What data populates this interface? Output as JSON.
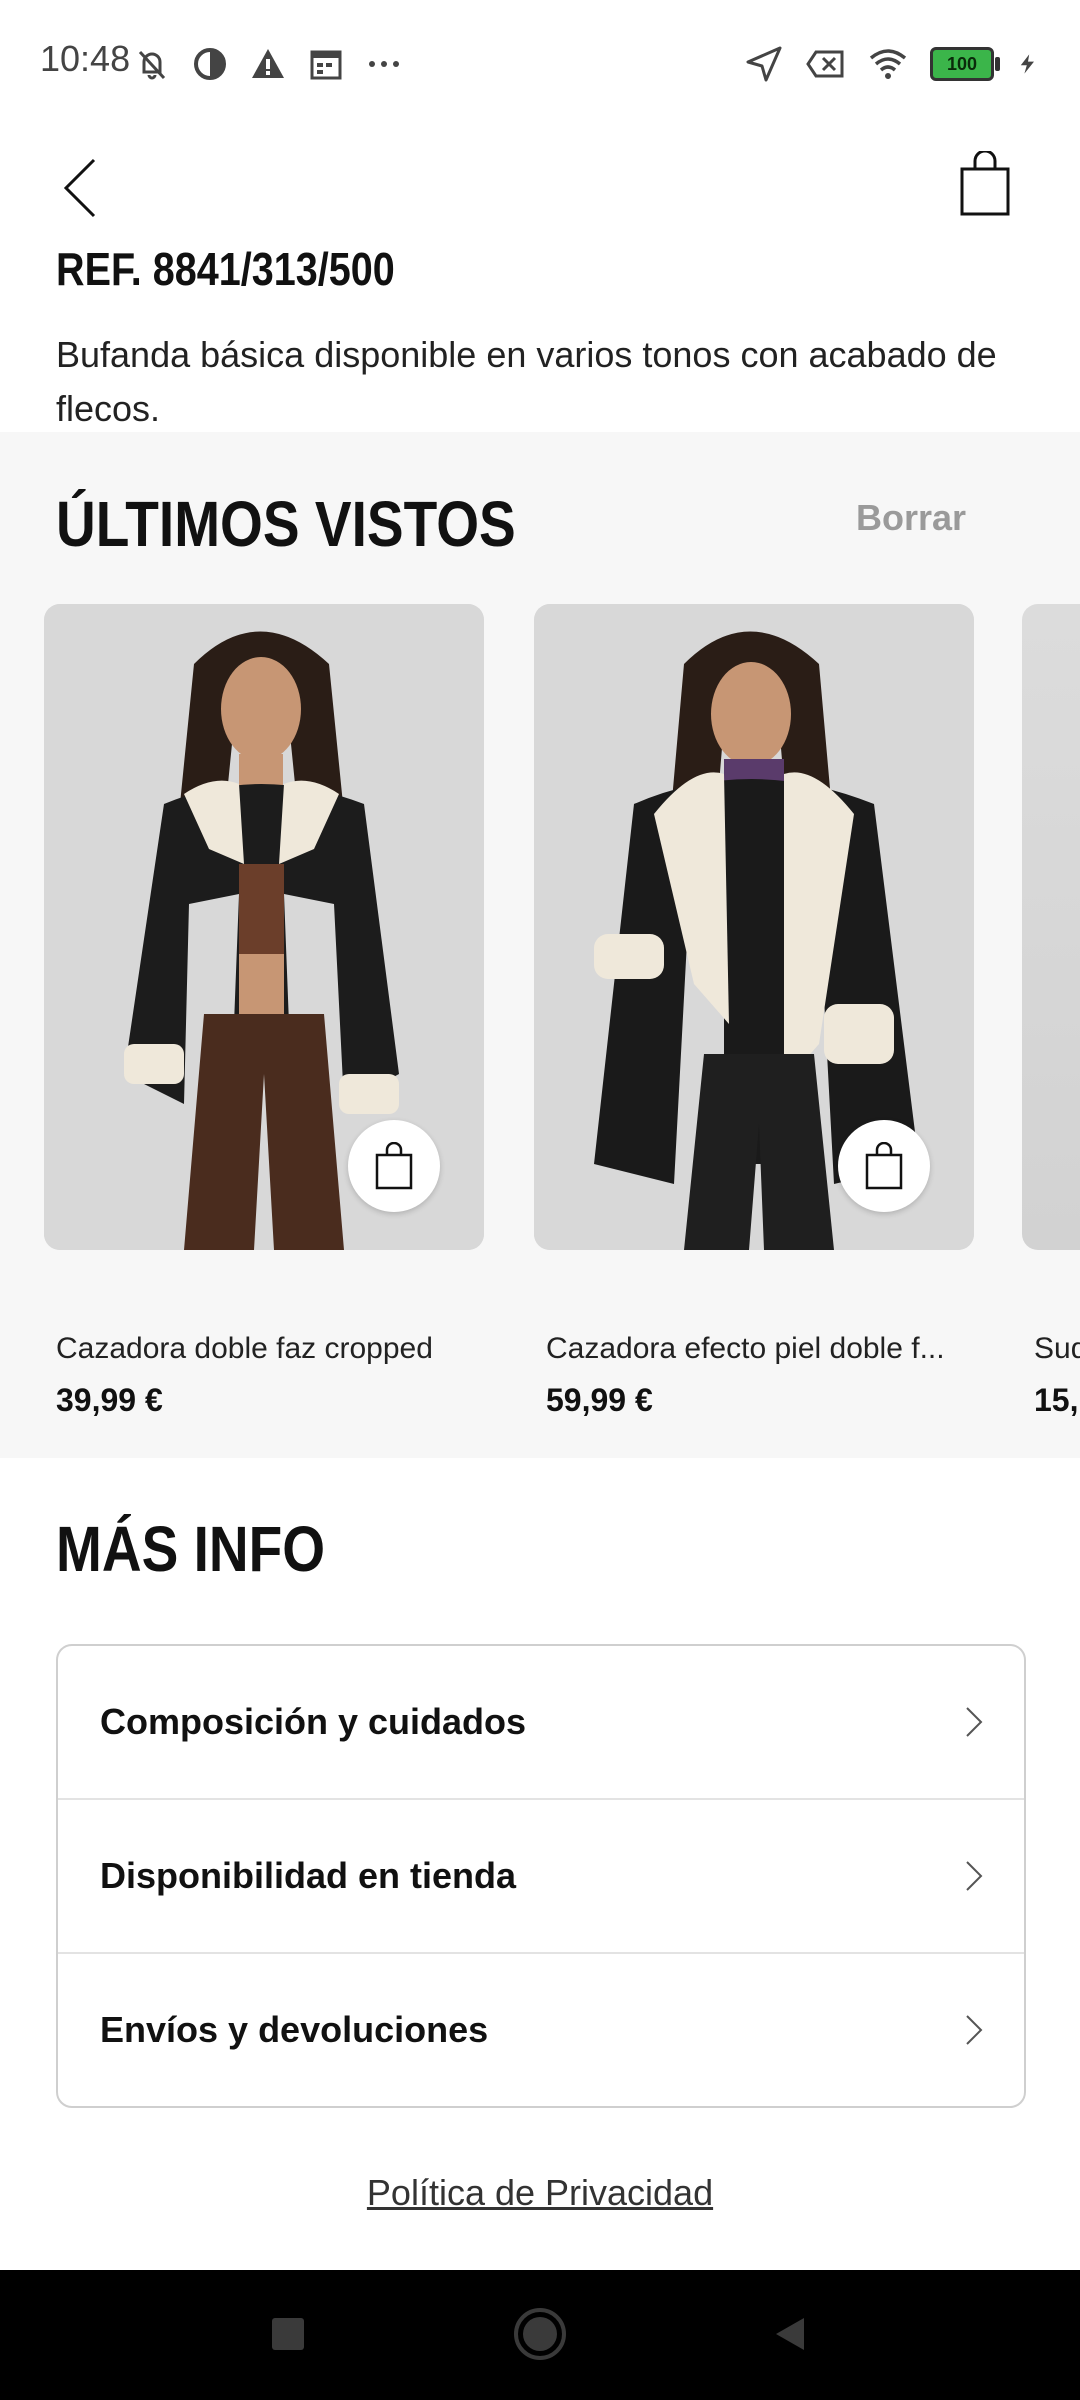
{
  "status_bar": {
    "time": "10:48",
    "battery": "100",
    "left_icons": [
      "mute-icon",
      "data-saver-icon",
      "warning-icon",
      "calendar-icon",
      "more-dots-icon"
    ],
    "right_icons": [
      "location-icon",
      "no-sim-icon",
      "wifi-icon",
      "battery-icon",
      "charging-icon"
    ]
  },
  "top_bar": {
    "back_icon": "back-chevron-icon",
    "bag_icon": "shopping-bag-icon"
  },
  "product": {
    "reference": "REF. 8841/313/500",
    "description": "Bufanda básica disponible en varios tonos con acabado de flecos."
  },
  "recently_viewed": {
    "title": "ÚLTIMOS VISTOS",
    "clear_label": "Borrar",
    "items": [
      {
        "name": "Cazadora doble faz cropped",
        "price": "39,99 €"
      },
      {
        "name": "Cazadora efecto piel doble f...",
        "price": "59,99 €"
      },
      {
        "name": "Sud",
        "price": "15,"
      }
    ]
  },
  "more_info": {
    "title": "MÁS INFO",
    "rows": [
      {
        "label": "Composición y cuidados"
      },
      {
        "label": "Disponibilidad en tienda"
      },
      {
        "label": "Envíos y devoluciones"
      }
    ]
  },
  "footer": {
    "privacy_link": "Política de Privacidad"
  },
  "colors": {
    "section_bg": "#f7f7f7",
    "muted_text": "#9a9a9a",
    "border": "#cfcfcf",
    "battery_green": "#3bb54a"
  }
}
